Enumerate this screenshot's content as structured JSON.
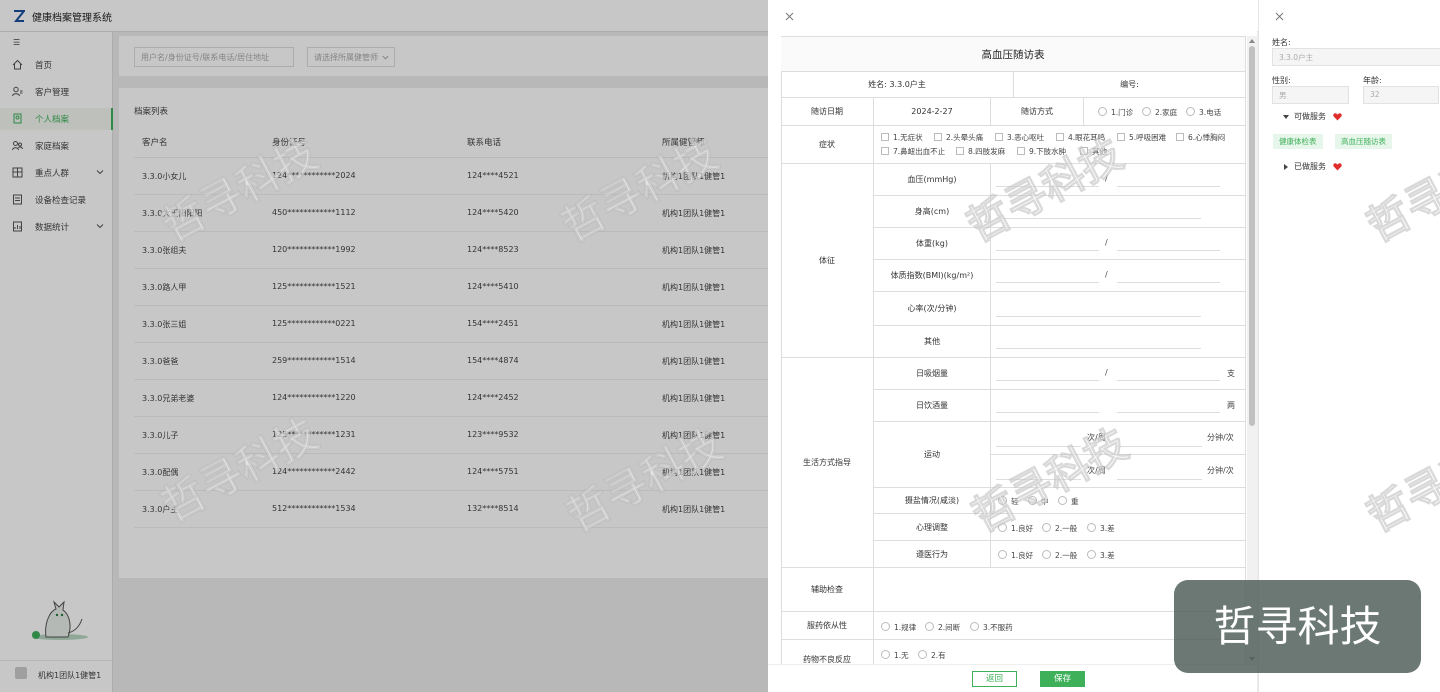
{
  "app": {
    "title": "健康档案管理系统"
  },
  "sidebar": {
    "collapse_label": "☰",
    "items": [
      {
        "label": "首页"
      },
      {
        "label": "客户管理"
      },
      {
        "label": "个人档案"
      },
      {
        "label": "家庭档案"
      },
      {
        "label": "重点人群"
      },
      {
        "label": "设备检查记录"
      },
      {
        "label": "数据统计"
      }
    ],
    "user": "机构1团队1健管1"
  },
  "main": {
    "search_placeholder": "用户名/身份证号/联系电话/居住地址",
    "select_placeholder": "请选择所属健管师",
    "list_title": "档案列表",
    "columns": [
      "客户名",
      "身份证号",
      "联系电话",
      "所属健管师"
    ],
    "rows": [
      [
        "3.3.0小女儿",
        "124************2024",
        "124****4521",
        "机构1团队1健管1"
      ],
      [
        "3.3.0大王阳阳阳",
        "450************1112",
        "124****5420",
        "机构1团队1健管1"
      ],
      [
        "3.3.0张组夫",
        "120************1992",
        "124****8523",
        "机构1团队1健管1"
      ],
      [
        "3.3.0路人甲",
        "125************1521",
        "124****5410",
        "机构1团队1健管1"
      ],
      [
        "3.3.0张三姐",
        "125************0221",
        "154****2451",
        "机构1团队1健管1"
      ],
      [
        "3.3.0爸爸",
        "259************1514",
        "154****4874",
        "机构1团队1健管1"
      ],
      [
        "3.3.0兄弟老婆",
        "124************1220",
        "124****2452",
        "机构1团队1健管1"
      ],
      [
        "3.3.0儿子",
        "125************1231",
        "123****9532",
        "机构1团队1健管1"
      ],
      [
        "3.3.0配偶",
        "124************2442",
        "124****5751",
        "机构1团队1健管1"
      ],
      [
        "3.3.0户主",
        "512************1534",
        "132****8514",
        "机构1团队1健管1"
      ]
    ]
  },
  "form": {
    "title": "高血压随访表",
    "name_label": "姓名: 3.3.0户主",
    "code_label": "编号:",
    "visit_date_label": "随访日期",
    "visit_date_value": "2024-2-27",
    "visit_mode_label": "随访方式",
    "visit_modes": [
      "1.门诊",
      "2.家庭",
      "3.电话"
    ],
    "symptom_label": "症状",
    "symptoms": [
      "1.无症状",
      "2.头晕头痛",
      "3.恶心呕吐",
      "4.眼花耳鸣",
      "5.呼吸困难",
      "6.心悸胸闷",
      "7.鼻衄出血不止",
      "8.四肢发麻",
      "9.下肢水肿",
      "其他"
    ],
    "sign_label": "体征",
    "signs": [
      "血压(mmHg)",
      "身高(cm)",
      "体重(kg)",
      "体质指数(BMI)(kg/m²)",
      "心率(次/分钟)",
      "其他"
    ],
    "slash": "/",
    "lifestyle_label": "生活方式指导",
    "smoke_label": "日吸烟量",
    "smoke_unit": "支",
    "drink_label": "日饮酒量",
    "drink_unit": "两",
    "sport_label": "运动",
    "sport_times": "次/周",
    "sport_minutes": "分钟/次",
    "salt_label": "摄盐情况(咸淡)",
    "salt_options": [
      "轻",
      "中",
      "重"
    ],
    "psych_label": "心理调整",
    "psych_options": [
      "1.良好",
      "2.一般",
      "3.差"
    ],
    "comply_label": "遵医行为",
    "comply_options": [
      "1.良好",
      "2.一般",
      "3.差"
    ],
    "aux_label": "辅助检查",
    "med_comply_label": "服药依从性",
    "med_comply_options": [
      "1.规律",
      "2.间断",
      "3.不服药"
    ],
    "adverse_label": "药物不良反应",
    "adverse_options": [
      "1.无",
      "2.有"
    ],
    "back_button": "返回",
    "save_button": "保存"
  },
  "side_panel": {
    "name_label": "姓名:",
    "name_value": "3.3.0户主",
    "gender_label": "性别:",
    "gender_value": "男",
    "age_label": "年龄:",
    "age_value": "32",
    "available_label": "可做服务",
    "available_tags": [
      "健康体检表",
      "高血压随访表"
    ],
    "done_label": "已做服务"
  },
  "watermark": {
    "text": "哲寻科技"
  },
  "brand": {
    "text": "哲寻科技"
  },
  "colors": {
    "accent": "#3eb05a",
    "heart": "#e02d2d",
    "mask": "rgba(0,0,0,0.22)"
  }
}
